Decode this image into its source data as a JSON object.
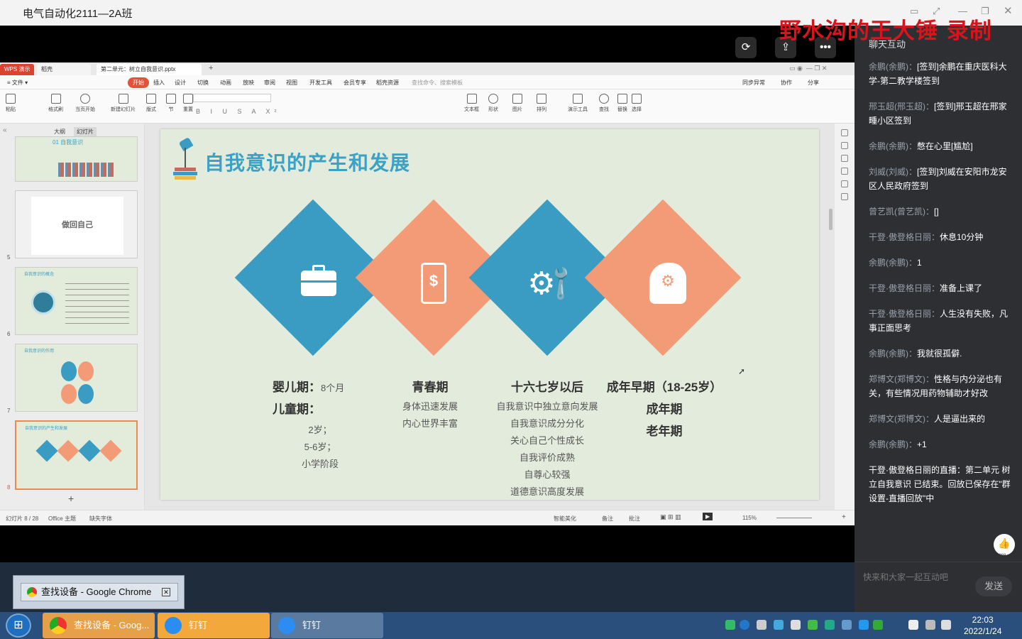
{
  "window": {
    "title": "电气自动化2111—2A班",
    "watermark": "野水沟的王大锤 录制"
  },
  "wps": {
    "tabs": [
      "WPS 演示",
      "稻壳",
      "第二单元：树立自我意识.pptx"
    ],
    "menu": [
      "≡ 文件 ▾",
      "开始",
      "插入",
      "设计",
      "切换",
      "动画",
      "放映",
      "审阅",
      "视图",
      "开发工具",
      "会员专享",
      "稻壳资源",
      "查找命令、搜索模板"
    ],
    "menu_right": [
      "同步异常",
      "协作",
      "分享"
    ],
    "ribbon": [
      "粘贴",
      "格式刷",
      "当页开始",
      "新建幻灯片",
      "版式",
      "节",
      "重置",
      "文本框",
      "形状",
      "图片",
      "排列",
      "演示工具",
      "查找",
      "替换",
      "选择"
    ],
    "panel_tabs": [
      "大纲",
      "幻灯片"
    ],
    "thumbs": [
      {
        "num": "",
        "title": "01  自我意识"
      },
      {
        "num": "5",
        "title": "做回自己"
      },
      {
        "num": "6",
        "title": "自我意识的概念"
      },
      {
        "num": "7",
        "title": "自我意识的作用"
      },
      {
        "num": "8",
        "title": "自我意识的产生和发展"
      }
    ],
    "status": {
      "slide": "幻灯片 8 / 28",
      "theme": "Office 主题",
      "font": "缺失字体",
      "beautify": "智能美化",
      "notes": "备注",
      "comment": "批注",
      "zoom": "115%"
    }
  },
  "slide": {
    "title": "自我意识的产生和发展",
    "diamonds": [
      {
        "color": "#3a9cc2",
        "icon": "briefcase-icon",
        "glyph": "💼"
      },
      {
        "color": "#f39b76",
        "icon": "money-phone-icon",
        "glyph": "$"
      },
      {
        "color": "#3a9cc2",
        "icon": "tools-icon",
        "glyph": "⚙"
      },
      {
        "color": "#f39b76",
        "icon": "head-gears-icon",
        "glyph": "⚙"
      }
    ],
    "col1": {
      "h1": "婴儿期：",
      "h1sub": "8个月",
      "h2": "儿童期：",
      "lines": [
        "2岁；",
        "5-6岁；",
        "小学阶段"
      ]
    },
    "col2": {
      "h": "青春期",
      "lines": [
        "身体迅速发展",
        "内心世界丰富"
      ]
    },
    "col3": {
      "h": "十六七岁以后",
      "lines": [
        "自我意识中独立意向发展",
        "自我意识成分分化",
        "关心自己个性成长",
        "自我评价成熟",
        "自尊心较强",
        "道德意识高度发展"
      ]
    },
    "col4": {
      "h": "成年早期（18-25岁）",
      "h2": "成年期",
      "h3": "老年期"
    }
  },
  "chat": {
    "title": "聊天互动",
    "messages": [
      {
        "name": "余鹏(余鹏)：",
        "text": "[签到]余鹏在重庆医科大学-第二教学楼签到"
      },
      {
        "name": "邢玉超(邢玉超)：",
        "text": "[签到]邢玉超在邢家畽小区签到"
      },
      {
        "name": "余鹏(余鹏)：",
        "text": "憋在心里[尴尬]"
      },
      {
        "name": "刘威(刘威)：",
        "text": "[签到]刘威在安阳市龙安区人民政府签到"
      },
      {
        "name": "曾艺凯(曾艺凯)：",
        "text": "[]"
      },
      {
        "name": "干登·傲登格日丽：",
        "text": "休息10分钟"
      },
      {
        "name": "余鹏(余鹏)：",
        "text": "1"
      },
      {
        "name": "干登·傲登格日丽：",
        "text": "准备上课了"
      },
      {
        "name": "干登·傲登格日丽：",
        "text": "人生没有失败，凡事正面思考"
      },
      {
        "name": "余鹏(余鹏)：",
        "text": "我就很孤僻."
      },
      {
        "name": "郑博文(郑博文)：",
        "text": "性格与内分泌也有关，有些情况用药物辅助才好改"
      },
      {
        "name": "郑博文(郑博文)：",
        "text": "人是逼出来的"
      },
      {
        "name": "余鹏(余鹏)：",
        "text": "+1"
      },
      {
        "name": "",
        "text": "干登·傲登格日丽的直播：第二单元 树立自我意识 已结束。回放已保存在\"群设置-直播回放\"中"
      }
    ],
    "like_count": "2288",
    "input_placeholder": "快来和大家一起互动吧",
    "send": "发送"
  },
  "desktop": {
    "preview": "查找设备 - Google Chrome"
  },
  "taskbar": {
    "items": [
      "查找设备 - Goog...",
      "钉钉",
      "钉钉"
    ],
    "time": "22:03",
    "date": "2022/1/24"
  }
}
